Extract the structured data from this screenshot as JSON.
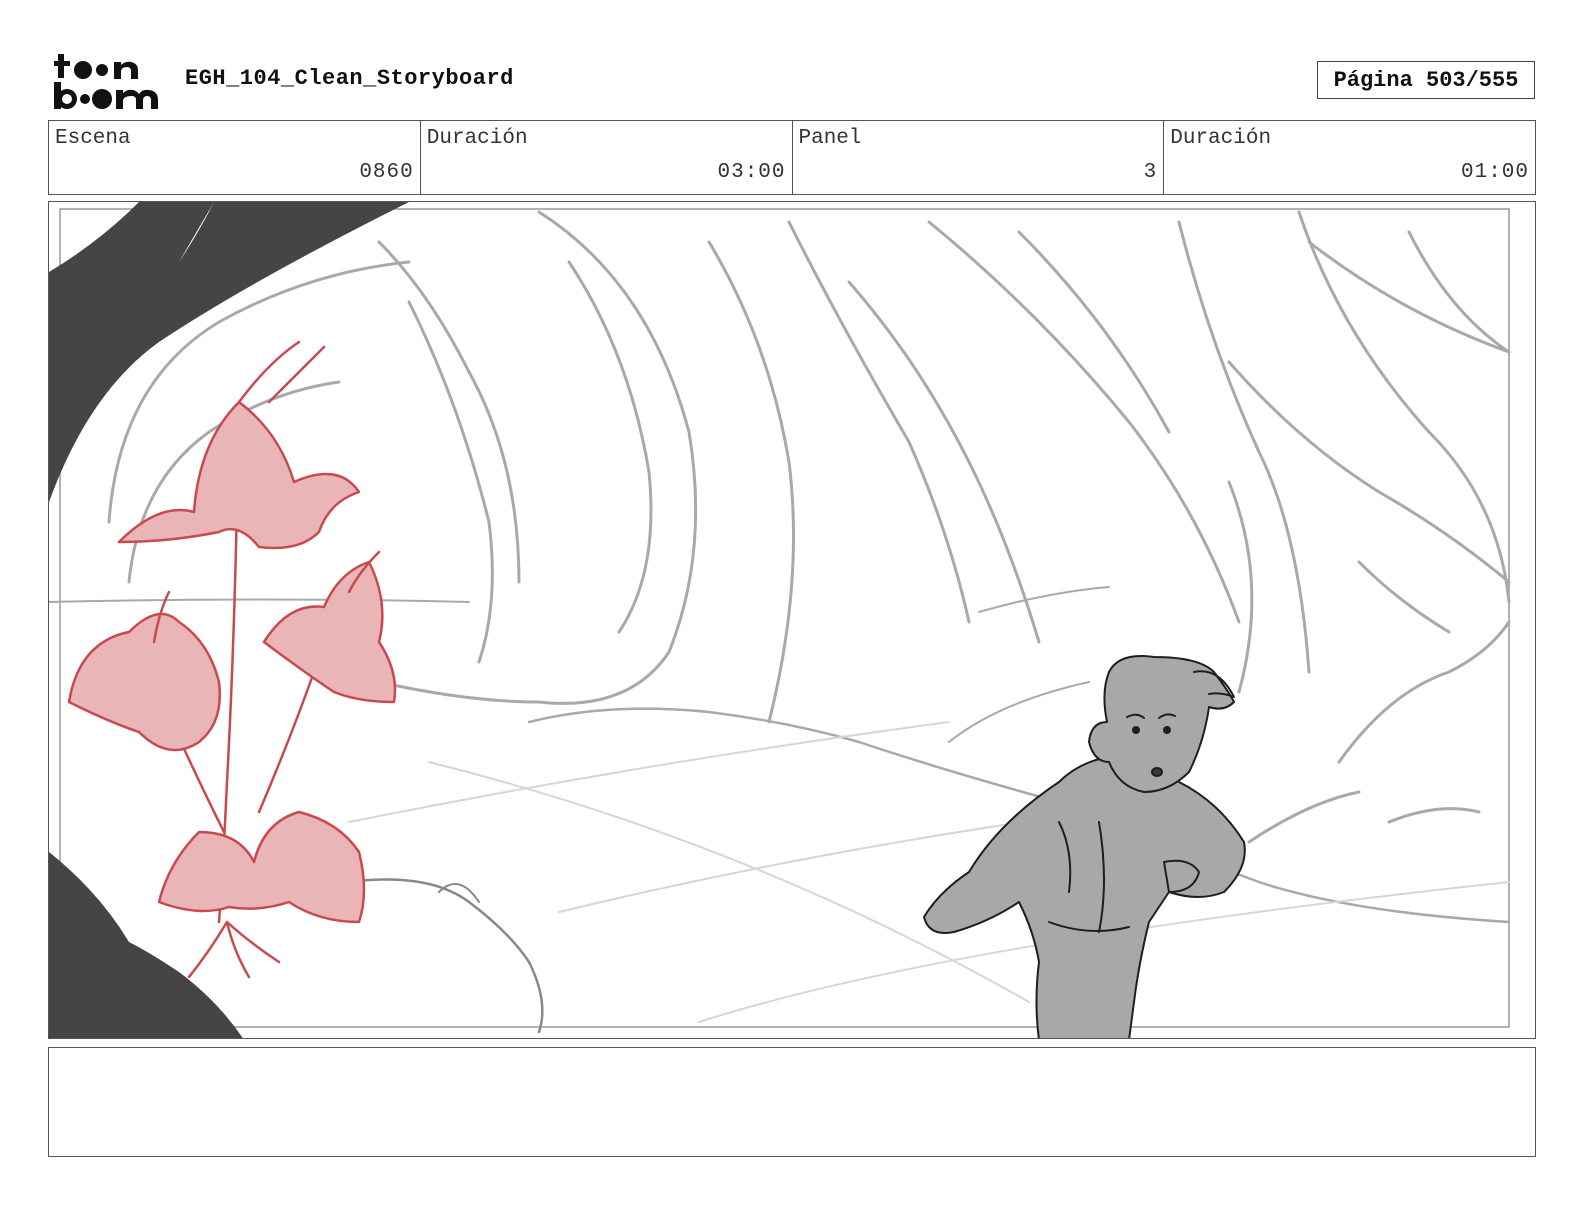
{
  "header": {
    "logo_text": "toon boom",
    "title": "EGH_104_Clean_Storyboard",
    "page_label": "Página",
    "page_value": "503/555"
  },
  "info": {
    "scene_label": "Escena",
    "scene_value": "0860",
    "scene_duration_label": "Duración",
    "scene_duration_value": "03:00",
    "panel_label": "Panel",
    "panel_value": "3",
    "panel_duration_label": "Duración",
    "panel_duration_value": "01:00"
  },
  "panel": {
    "colors": {
      "sketch_gray": "#a9a9a9",
      "branch_dark": "#454545",
      "flower_red": "#c84a4f",
      "flower_fill": "#eab5b7",
      "character_fill": "#a8a8a8",
      "character_line": "#1e1e1e"
    }
  },
  "notes": {
    "text": ""
  }
}
